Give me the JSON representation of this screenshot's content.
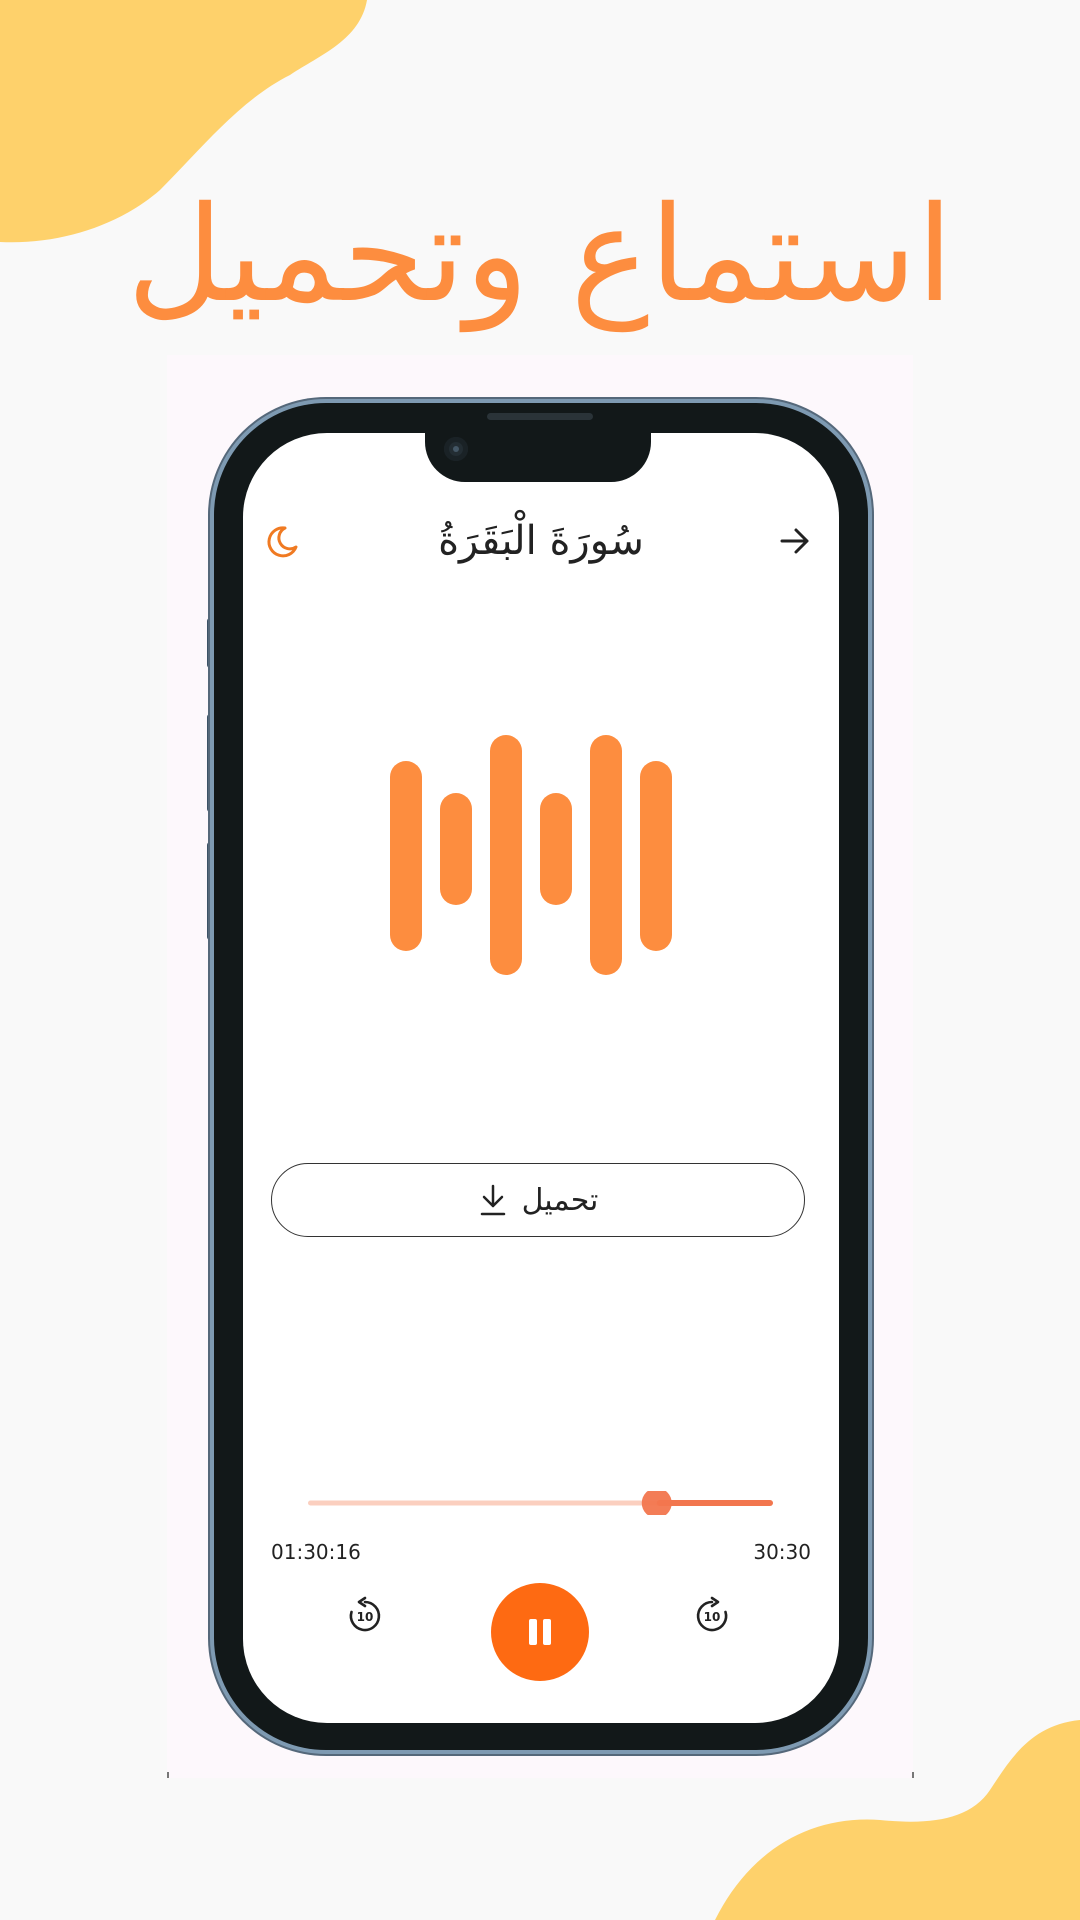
{
  "headline": "استماع وتحميل",
  "colors": {
    "accent_orange": "#fd8d3f",
    "play_orange": "#fe6a12",
    "slider_active": "#f2764e",
    "slider_track": "#fbcfbf",
    "blob_yellow": "#fed16b",
    "phone_frame": "#121819"
  },
  "player": {
    "surah_title": "سُورَةَ الْبَقَرَةُ",
    "theme_icon": "moon-icon",
    "back_icon": "arrow-right-icon",
    "waveform_icon": "sound-wave-icon",
    "download": {
      "label": "تحميل",
      "icon": "download-icon"
    },
    "progress": {
      "elapsed_fraction": 0.25,
      "time_left": "01:30:16",
      "time_right": "30:30"
    },
    "controls": {
      "rewind_label": "10",
      "forward_label": "10",
      "play_state": "pause-icon"
    }
  }
}
